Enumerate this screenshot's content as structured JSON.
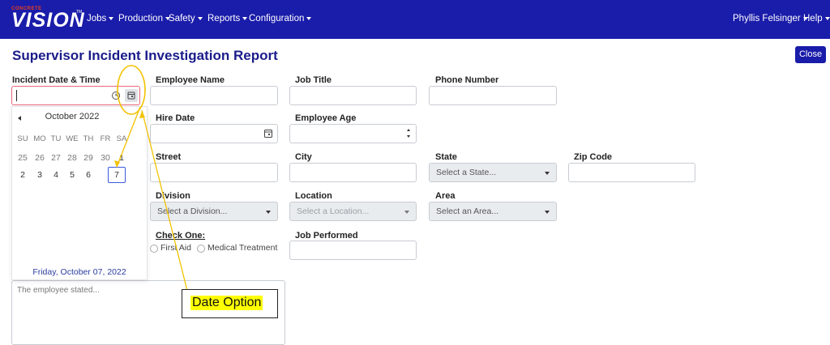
{
  "app": {
    "logo_small": "CONCRETE",
    "logo_big": "VISION",
    "logo_tm": "TM"
  },
  "nav": {
    "items": [
      "Jobs",
      "Production",
      "Safety",
      "Reports",
      "Configuration"
    ],
    "user": "Phyllis Felsinger",
    "help": "Help"
  },
  "page": {
    "title": "Supervisor Incident Investigation Report",
    "close_label": "Close"
  },
  "form": {
    "incident_date_label": "Incident Date & Time",
    "incident_date_value": "",
    "employee_name_label": "Employee Name",
    "job_title_label": "Job Title",
    "phone_label": "Phone Number",
    "hire_date_label": "Hire Date",
    "employee_age_label": "Employee Age",
    "street_label": "Street",
    "city_label": "City",
    "state_label": "State",
    "state_placeholder": "Select a State...",
    "zip_label": "Zip Code",
    "division_label": "Division",
    "division_placeholder": "Select a Division...",
    "location_label": "Location",
    "location_placeholder": "Select a Location...",
    "area_label": "Area",
    "area_placeholder": "Select an Area...",
    "check_one_label": "Check One:",
    "radio_first_aid": "First Aid",
    "radio_medical": "Medical Treatment",
    "job_performed_label": "Job Performed",
    "statement_placeholder": "The employee stated..."
  },
  "calendar": {
    "month_label": "October 2022",
    "weekdays": [
      "SU",
      "MO",
      "TU",
      "WE",
      "TH",
      "FR",
      "SA"
    ],
    "week1": [
      "25",
      "26",
      "27",
      "28",
      "29",
      "30",
      "1"
    ],
    "week2": [
      "2",
      "3",
      "4",
      "5",
      "6",
      "7"
    ],
    "selected_day": "7",
    "footer": "Friday, October 07, 2022"
  },
  "annotation": {
    "callout": "Date Option",
    "color": "#f2c200"
  },
  "colors": {
    "navbar": "#1a1caa",
    "title": "#1a1c8a",
    "focus_border": "#e8687a",
    "selected_day_border": "#3b5bdb"
  }
}
